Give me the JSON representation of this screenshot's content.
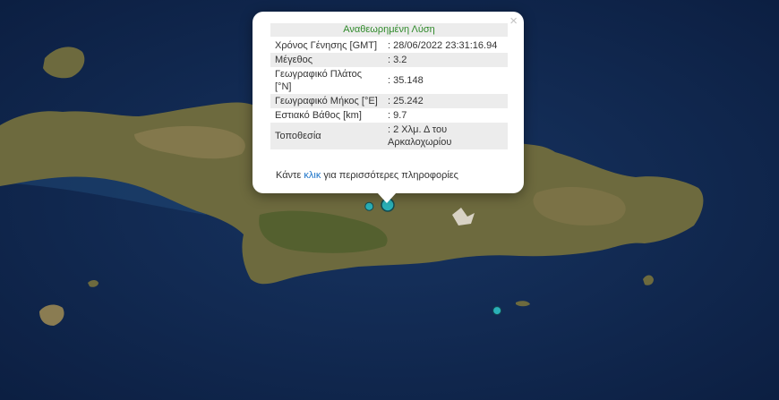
{
  "map": {
    "colors": {
      "sea": "#142c54",
      "land": "#6d6a3e",
      "highland": "#8a7c52",
      "green": "#4e5e2c"
    },
    "markers": [
      {
        "name": "selected-quake-marker",
        "lon": 25.242,
        "lat": 35.148,
        "color": "#2ab0b7"
      },
      {
        "name": "quake-marker-2",
        "lon": 25.12,
        "lat": 35.14,
        "color": "#2ab0b7"
      },
      {
        "name": "quake-marker-3",
        "lon": 25.96,
        "lat": 34.58,
        "color": "#2ab0b7"
      },
      {
        "name": "quake-marker-4",
        "lon": 24.53,
        "lat": 35.86,
        "color": "#e2b43a"
      }
    ]
  },
  "popup": {
    "title": "Αναθεωρημένη Λύση",
    "close_label": "×",
    "rows": [
      {
        "label": "Χρόνος Γένησης [GMT]",
        "value": ": 28/06/2022 23:31:16.94"
      },
      {
        "label": "Μέγεθος",
        "value": ": 3.2"
      },
      {
        "label": "Γεωγραφικό Πλάτος [°N]",
        "value": ": 35.148"
      },
      {
        "label": "Γεωγραφικό Μήκος [°E]",
        "value": ": 25.242"
      },
      {
        "label": "Εστιακό Βάθος [km]",
        "value": ": 9.7"
      },
      {
        "label": "Τοποθεσία",
        "value": ": 2 Χλμ. Δ του Αρκαλοχωρίου"
      }
    ],
    "more_prefix": "Κάντε ",
    "more_link": "κλικ",
    "more_suffix": " για περισσότερες πληροφορίες"
  }
}
